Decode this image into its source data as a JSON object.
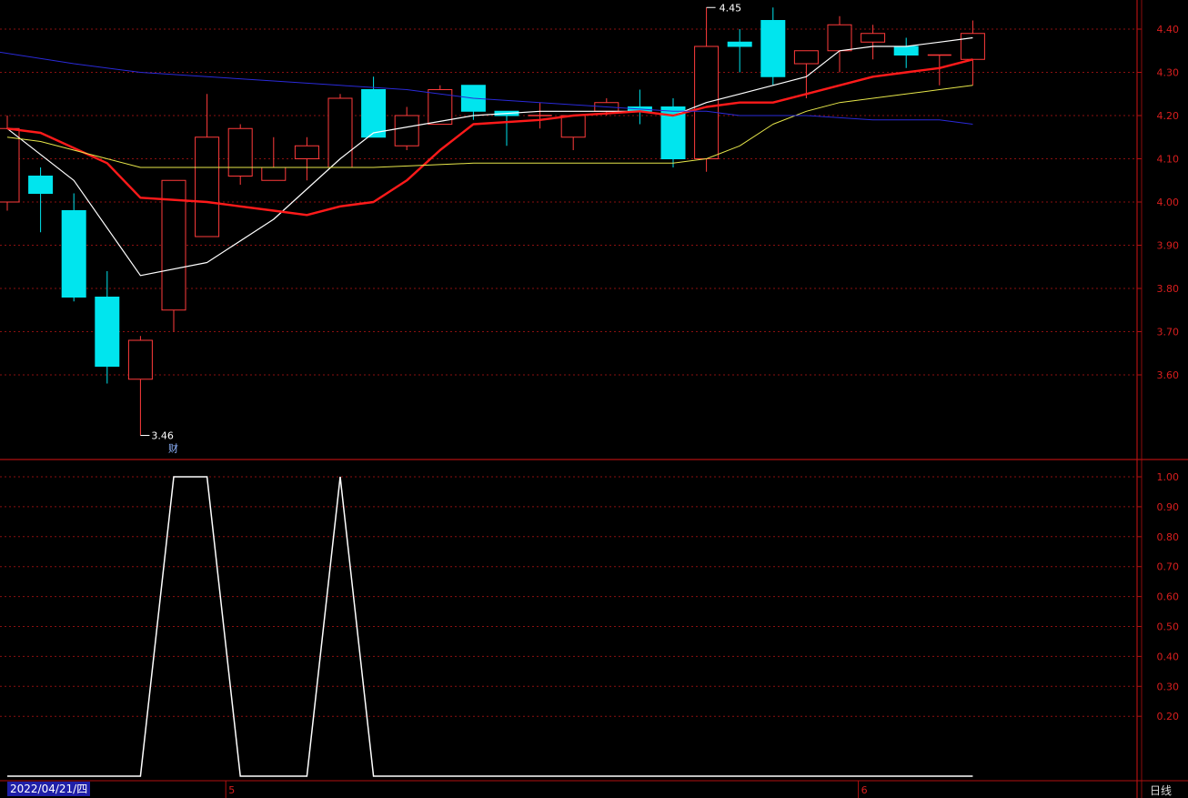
{
  "colors": {
    "background": "#000000",
    "up": "#ff3b3b",
    "down": "#00e5ee",
    "grid": "#8a1010",
    "axis": "#b01010",
    "axis_text": "#d81e1e",
    "ma_white": "#ffffff",
    "ma_red": "#ff1a1a",
    "ma_yellow": "#e6e64a",
    "ma_blue": "#2a2ad8",
    "indicator": "#ffffff"
  },
  "chart_data": [
    {
      "type": "candlestick",
      "ylim": [
        3.46,
        4.48
      ],
      "y_ticks": [
        "4.40",
        "4.30",
        "4.20",
        "4.10",
        "4.00",
        "3.90",
        "3.80",
        "3.70",
        "3.60"
      ],
      "y_tick_values": [
        4.4,
        4.3,
        4.2,
        4.1,
        4.0,
        3.9,
        3.8,
        3.7,
        3.6
      ],
      "annotations": {
        "high_label": "4.45",
        "low_label": "3.46",
        "event_marker": "财"
      },
      "candles": [
        {
          "o": 4.0,
          "h": 4.2,
          "l": 3.98,
          "c": 4.17
        },
        {
          "o": 4.06,
          "h": 4.08,
          "l": 3.93,
          "c": 4.02
        },
        {
          "o": 3.98,
          "h": 4.02,
          "l": 3.77,
          "c": 3.78
        },
        {
          "o": 3.78,
          "h": 3.84,
          "l": 3.58,
          "c": 3.62
        },
        {
          "o": 3.59,
          "h": 3.69,
          "l": 3.46,
          "c": 3.68
        },
        {
          "o": 3.75,
          "h": 4.05,
          "l": 3.7,
          "c": 4.05
        },
        {
          "o": 3.92,
          "h": 4.25,
          "l": 3.92,
          "c": 4.15
        },
        {
          "o": 4.06,
          "h": 4.18,
          "l": 4.04,
          "c": 4.17
        },
        {
          "o": 4.05,
          "h": 4.15,
          "l": 4.05,
          "c": 4.08
        },
        {
          "o": 4.1,
          "h": 4.15,
          "l": 4.05,
          "c": 4.13
        },
        {
          "o": 4.08,
          "h": 4.25,
          "l": 4.08,
          "c": 4.24
        },
        {
          "o": 4.26,
          "h": 4.29,
          "l": 4.15,
          "c": 4.15
        },
        {
          "o": 4.13,
          "h": 4.22,
          "l": 4.12,
          "c": 4.2
        },
        {
          "o": 4.18,
          "h": 4.27,
          "l": 4.18,
          "c": 4.26
        },
        {
          "o": 4.27,
          "h": 4.27,
          "l": 4.19,
          "c": 4.21
        },
        {
          "o": 4.21,
          "h": 4.21,
          "l": 4.13,
          "c": 4.2
        },
        {
          "o": 4.2,
          "h": 4.23,
          "l": 4.17,
          "c": 4.2
        },
        {
          "o": 4.15,
          "h": 4.2,
          "l": 4.12,
          "c": 4.2
        },
        {
          "o": 4.21,
          "h": 4.24,
          "l": 4.2,
          "c": 4.23
        },
        {
          "o": 4.22,
          "h": 4.26,
          "l": 4.18,
          "c": 4.21
        },
        {
          "o": 4.22,
          "h": 4.24,
          "l": 4.08,
          "c": 4.1
        },
        {
          "o": 4.1,
          "h": 4.45,
          "l": 4.07,
          "c": 4.36
        },
        {
          "o": 4.37,
          "h": 4.4,
          "l": 4.3,
          "c": 4.36
        },
        {
          "o": 4.42,
          "h": 4.45,
          "l": 4.27,
          "c": 4.29
        },
        {
          "o": 4.32,
          "h": 4.35,
          "l": 4.24,
          "c": 4.35
        },
        {
          "o": 4.35,
          "h": 4.43,
          "l": 4.3,
          "c": 4.41
        },
        {
          "o": 4.37,
          "h": 4.41,
          "l": 4.33,
          "c": 4.39
        },
        {
          "o": 4.36,
          "h": 4.38,
          "l": 4.31,
          "c": 4.34
        },
        {
          "o": 4.34,
          "h": 4.34,
          "l": 4.27,
          "c": 4.34
        },
        {
          "o": 4.33,
          "h": 4.42,
          "l": 4.27,
          "c": 4.39
        }
      ],
      "ma_lines": [
        {
          "color_key": "ma_white",
          "width": 1.2,
          "points": [
            [
              0,
              4.17
            ],
            [
              2,
              4.05
            ],
            [
              4,
              3.83
            ],
            [
              6,
              3.86
            ],
            [
              8,
              3.96
            ],
            [
              10,
              4.1
            ],
            [
              11,
              4.16
            ],
            [
              14,
              4.2
            ],
            [
              16,
              4.21
            ],
            [
              18,
              4.21
            ],
            [
              19,
              4.21
            ],
            [
              20,
              4.2
            ],
            [
              21,
              4.23
            ],
            [
              22,
              4.25
            ],
            [
              23,
              4.27
            ],
            [
              24,
              4.29
            ],
            [
              25,
              4.35
            ],
            [
              26,
              4.36
            ],
            [
              27,
              4.36
            ],
            [
              28,
              4.37
            ],
            [
              29,
              4.38
            ]
          ]
        },
        {
          "color_key": "ma_red",
          "width": 2.4,
          "points": [
            [
              0,
              4.17
            ],
            [
              1,
              4.16
            ],
            [
              3,
              4.09
            ],
            [
              4,
              4.01
            ],
            [
              6,
              4.0
            ],
            [
              7,
              3.99
            ],
            [
              8,
              3.98
            ],
            [
              9,
              3.97
            ],
            [
              10,
              3.99
            ],
            [
              11,
              4.0
            ],
            [
              12,
              4.05
            ],
            [
              13,
              4.12
            ],
            [
              14,
              4.18
            ],
            [
              16,
              4.19
            ],
            [
              17,
              4.2
            ],
            [
              19,
              4.21
            ],
            [
              20,
              4.2
            ],
            [
              21,
              4.22
            ],
            [
              22,
              4.23
            ],
            [
              23,
              4.23
            ],
            [
              24,
              4.25
            ],
            [
              25,
              4.27
            ],
            [
              26,
              4.29
            ],
            [
              27,
              4.3
            ],
            [
              28,
              4.31
            ],
            [
              29,
              4.33
            ]
          ]
        },
        {
          "color_key": "ma_yellow",
          "width": 1.0,
          "points": [
            [
              0,
              4.15
            ],
            [
              1,
              4.14
            ],
            [
              3,
              4.1
            ],
            [
              4,
              4.08
            ],
            [
              6,
              4.08
            ],
            [
              8,
              4.08
            ],
            [
              11,
              4.08
            ],
            [
              14,
              4.09
            ],
            [
              16,
              4.09
            ],
            [
              18,
              4.09
            ],
            [
              20,
              4.09
            ],
            [
              21,
              4.1
            ],
            [
              22,
              4.13
            ],
            [
              23,
              4.18
            ],
            [
              24,
              4.21
            ],
            [
              25,
              4.23
            ],
            [
              26,
              4.24
            ],
            [
              27,
              4.25
            ],
            [
              28,
              4.26
            ],
            [
              29,
              4.27
            ]
          ]
        },
        {
          "color_key": "ma_blue",
          "width": 1.0,
          "points": [
            [
              -0.5,
              4.35
            ],
            [
              2,
              4.32
            ],
            [
              4,
              4.3
            ],
            [
              6,
              4.29
            ],
            [
              8,
              4.28
            ],
            [
              10,
              4.27
            ],
            [
              12,
              4.26
            ],
            [
              14,
              4.24
            ],
            [
              16,
              4.23
            ],
            [
              18,
              4.22
            ],
            [
              20,
              4.21
            ],
            [
              21,
              4.21
            ],
            [
              22,
              4.2
            ],
            [
              24,
              4.2
            ],
            [
              26,
              4.19
            ],
            [
              28,
              4.19
            ],
            [
              29,
              4.18
            ]
          ]
        }
      ]
    },
    {
      "type": "line",
      "ylim": [
        0,
        1.0
      ],
      "y_ticks": [
        "1.00",
        "0.90",
        "0.80",
        "0.70",
        "0.60",
        "0.50",
        "0.40",
        "0.30",
        "0.20"
      ],
      "y_tick_values": [
        1.0,
        0.9,
        0.8,
        0.7,
        0.6,
        0.5,
        0.4,
        0.3,
        0.2
      ],
      "series": [
        {
          "values": [
            0,
            0,
            0,
            0,
            0,
            1,
            1,
            0,
            0,
            0,
            1,
            0,
            0,
            0,
            0,
            0,
            0,
            0,
            0,
            0,
            0,
            0,
            0,
            0,
            0,
            0,
            0,
            0,
            0,
            0
          ]
        }
      ]
    }
  ],
  "footer": {
    "date_label": "2022/04/21/四",
    "month_markers": [
      {
        "index": 7,
        "label": "5"
      },
      {
        "index": 26,
        "label": "6"
      }
    ],
    "period_label": "日线"
  }
}
